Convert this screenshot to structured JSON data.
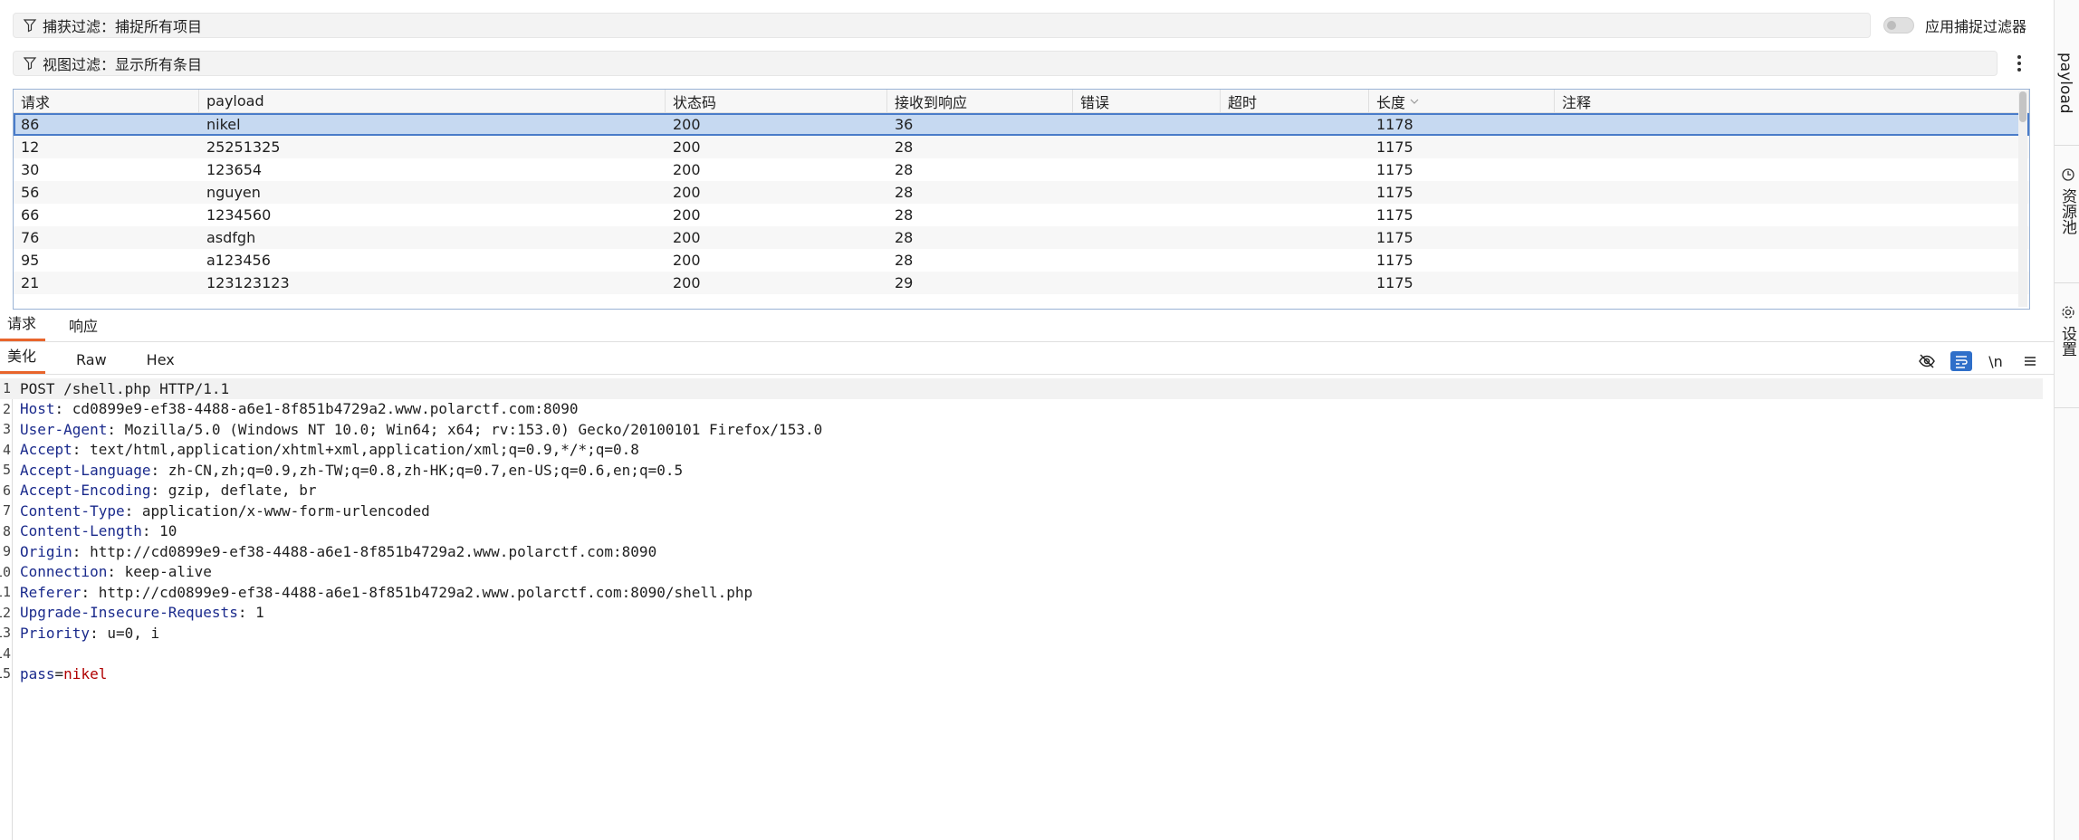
{
  "filters": {
    "capture_label": "捕获过滤：捕捉所有项目",
    "view_label": "视图过滤：显示所有条目",
    "apply_capture_label": "应用捕捉过滤器"
  },
  "table": {
    "columns": [
      "请求",
      "payload",
      "状态码",
      "接收到响应",
      "错误",
      "超时",
      "长度",
      "注释"
    ],
    "sorted_column_index": 6,
    "rows": [
      {
        "req": "86",
        "payload": "nikel",
        "status": "200",
        "resp": "36",
        "error": "",
        "timeout": "",
        "length": "1178",
        "comment": ""
      },
      {
        "req": "12",
        "payload": "25251325",
        "status": "200",
        "resp": "28",
        "error": "",
        "timeout": "",
        "length": "1175",
        "comment": ""
      },
      {
        "req": "30",
        "payload": "123654",
        "status": "200",
        "resp": "28",
        "error": "",
        "timeout": "",
        "length": "1175",
        "comment": ""
      },
      {
        "req": "56",
        "payload": "nguyen",
        "status": "200",
        "resp": "28",
        "error": "",
        "timeout": "",
        "length": "1175",
        "comment": ""
      },
      {
        "req": "66",
        "payload": "1234560",
        "status": "200",
        "resp": "28",
        "error": "",
        "timeout": "",
        "length": "1175",
        "comment": ""
      },
      {
        "req": "76",
        "payload": "asdfgh",
        "status": "200",
        "resp": "28",
        "error": "",
        "timeout": "",
        "length": "1175",
        "comment": ""
      },
      {
        "req": "95",
        "payload": "a123456",
        "status": "200",
        "resp": "28",
        "error": "",
        "timeout": "",
        "length": "1175",
        "comment": ""
      },
      {
        "req": "21",
        "payload": "123123123",
        "status": "200",
        "resp": "29",
        "error": "",
        "timeout": "",
        "length": "1175",
        "comment": ""
      }
    ],
    "selected_row_index": 0
  },
  "tabs": {
    "request_label": "请求",
    "response_label": "响应"
  },
  "subtabs": {
    "pretty_label": "美化",
    "raw_label": "Raw",
    "hex_label": "Hex",
    "newline_label": "\\n"
  },
  "editor": {
    "lines": [
      {
        "num": "1",
        "kind": "plain",
        "text": "POST /shell.php HTTP/1.1"
      },
      {
        "num": "2",
        "kind": "header",
        "name": "Host",
        "value": "cd0899e9-ef38-4488-a6e1-8f851b4729a2.www.polarctf.com:8090"
      },
      {
        "num": "3",
        "kind": "header",
        "name": "User-Agent",
        "value": "Mozilla/5.0 (Windows NT 10.0; Win64; x64; rv:153.0) Gecko/20100101 Firefox/153.0"
      },
      {
        "num": "4",
        "kind": "header",
        "name": "Accept",
        "value": "text/html,application/xhtml+xml,application/xml;q=0.9,*/*;q=0.8"
      },
      {
        "num": "5",
        "kind": "header",
        "name": "Accept-Language",
        "value": "zh-CN,zh;q=0.9,zh-TW;q=0.8,zh-HK;q=0.7,en-US;q=0.6,en;q=0.5"
      },
      {
        "num": "6",
        "kind": "header",
        "name": "Accept-Encoding",
        "value": "gzip, deflate, br"
      },
      {
        "num": "7",
        "kind": "header",
        "name": "Content-Type",
        "value": "application/x-www-form-urlencoded"
      },
      {
        "num": "8",
        "kind": "header",
        "name": "Content-Length",
        "value": "10"
      },
      {
        "num": "9",
        "kind": "header",
        "name": "Origin",
        "value": "http://cd0899e9-ef38-4488-a6e1-8f851b4729a2.www.polarctf.com:8090"
      },
      {
        "num": "10",
        "kind": "header",
        "name": "Connection",
        "value": "keep-alive"
      },
      {
        "num": "11",
        "kind": "header",
        "name": "Referer",
        "value": "http://cd0899e9-ef38-4488-a6e1-8f851b4729a2.www.polarctf.com:8090/shell.php"
      },
      {
        "num": "12",
        "kind": "header",
        "name": "Upgrade-Insecure-Requests",
        "value": "1"
      },
      {
        "num": "13",
        "kind": "header",
        "name": "Priority",
        "value": "u=0, i"
      },
      {
        "num": "14",
        "kind": "plain",
        "text": ""
      },
      {
        "num": "15",
        "kind": "param",
        "key": "pass",
        "value": "nikel"
      }
    ]
  },
  "right_panel": {
    "payload_label": "payload",
    "resource_label": "资源池",
    "settings_label": "设置"
  },
  "colors": {
    "accent_tab": "#e8652c",
    "selection": "#c6d9f1",
    "header_name": "#1a2a8c",
    "param_value": "#b00000"
  }
}
